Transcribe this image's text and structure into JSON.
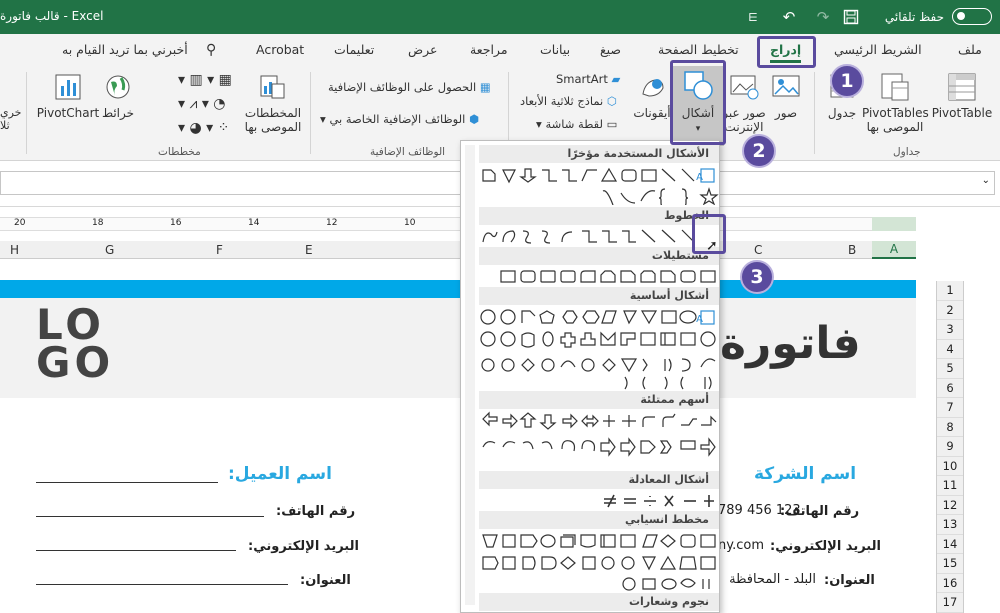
{
  "titlebar": {
    "autosave_label": "حفظ تلقائي",
    "title": "قالب فاتورة - Excel",
    "icons": [
      "save-icon",
      "redo-icon",
      "undo-icon",
      "customize-qat-icon"
    ]
  },
  "tabs": [
    {
      "label": "ملف"
    },
    {
      "label": "الشريط الرئيسي"
    },
    {
      "label": "إدراج",
      "active": true
    },
    {
      "label": "تخطيط الصفحة"
    },
    {
      "label": "صيغ"
    },
    {
      "label": "بيانات"
    },
    {
      "label": "مراجعة"
    },
    {
      "label": "عرض"
    },
    {
      "label": "تعليمات"
    },
    {
      "label": "Acrobat"
    },
    {
      "label": "أخبرني بما تريد القيام به"
    }
  ],
  "ribbon": {
    "pivottable": "PivotTable",
    "recommended_pivot": "PivotTables",
    "recommended_pivot_sub": "الموصى بها",
    "table": "جدول",
    "pictures": "صور",
    "online_pictures": "صور عبر",
    "online_pictures_sub": "الإنترنت",
    "shapes": "أشكال",
    "icons": "أيقونات",
    "smartart": "SmartArt",
    "models3d": "نماذج ثلاثية الأبعاد",
    "screenshot": "لقطة شاشة",
    "get_addins": "الحصول على الوظائف الإضافية",
    "my_addins": "الوظائف الإضافية الخاصة بي",
    "recommended_charts": "المخططات",
    "recommended_charts_sub": "الموصى بها",
    "maps": "خرائط",
    "pivotchart": "PivotChart",
    "group_tables": "جداول",
    "group_addins": "الوظائف الإضافية",
    "group_charts": "مخططات",
    "cut_left_1": "خري",
    "cut_left_2": "ثلا"
  },
  "ruler": [
    "20",
    "18",
    "16",
    "14",
    "12",
    "10",
    "8",
    "6",
    "4",
    "2",
    "2",
    "4"
  ],
  "columns": [
    "A",
    "B",
    "C",
    "E",
    "F",
    "G",
    "H"
  ],
  "rows": [
    "1",
    "2",
    "3",
    "4",
    "5",
    "6",
    "7",
    "8",
    "9",
    "10",
    "11",
    "12",
    "13",
    "14",
    "15",
    "16",
    "17"
  ],
  "sheet": {
    "logo_line1": "LO",
    "logo_line2": "GO",
    "invoice_title": "فاتورة",
    "company_name": "اسم الشركة",
    "phone_label": "رقم الهاتف:",
    "phone_value": "789 456 123",
    "email_label": "البريد الإلكتروني:",
    "email_value": "ny.com",
    "address_label": "العنوان:",
    "address_value": "البلد - المحافظة",
    "client_name": "اسم العميل:",
    "client_phone": "رقم الهاتف:",
    "client_email": "البريد الإلكتروني:",
    "client_address": "العنوان:"
  },
  "gallery": {
    "sections": [
      "الأشكال المستخدمة مؤخرًا",
      "الخطوط",
      "مستطيلات",
      "أشكال أساسية",
      "أسهم ممتلئة",
      "أشكال المعادلة",
      "مخطط انسيابي",
      "نجوم وشعارات"
    ]
  },
  "callouts": [
    "1",
    "2",
    "3"
  ],
  "colors": {
    "excel_green": "#217346",
    "accent_blue": "#29a8e0",
    "highlight": "#5a4b9e"
  }
}
